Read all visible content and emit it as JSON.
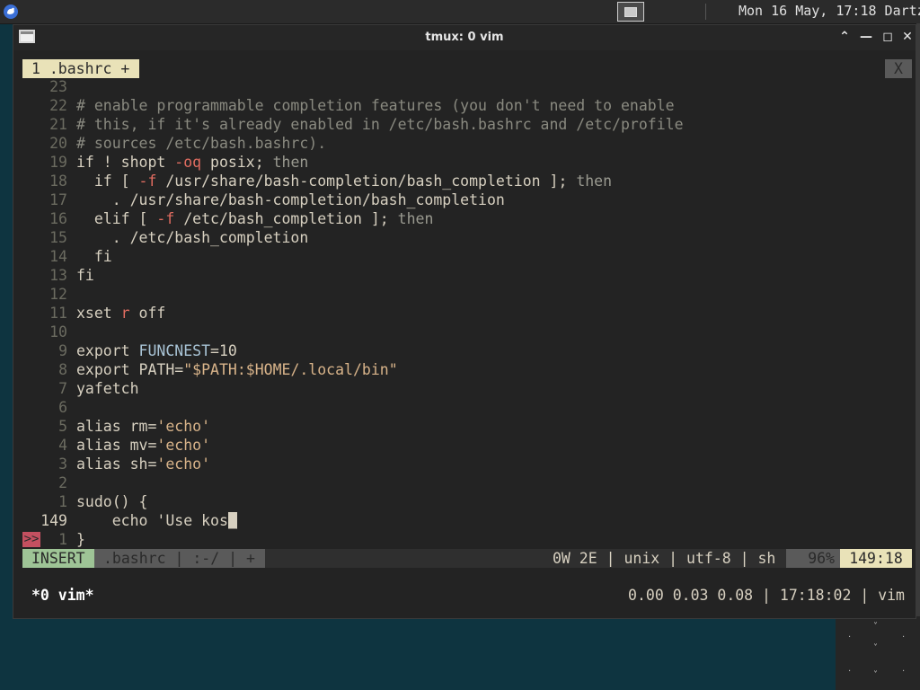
{
  "panel": {
    "clock": "Mon 16 May, 17:18 Dartz"
  },
  "window": {
    "title": "tmux: 0 vim",
    "buttons": {
      "chevron": "⌃",
      "minimize": "—",
      "maximize": "◻",
      "close": "✕"
    }
  },
  "vim": {
    "tab_label": "1 .bashrc +",
    "tab_close": "X",
    "lines": [
      {
        "num": "23",
        "text": ""
      },
      {
        "num": "22",
        "text": "# enable programmable completion features (you don't need to enable"
      },
      {
        "num": "21",
        "text": "# this, if it's already enabled in /etc/bash.bashrc and /etc/profile"
      },
      {
        "num": "20",
        "text": "# sources /etc/bash.bashrc)."
      },
      {
        "num": "19",
        "text": "if ! shopt -oq posix; then"
      },
      {
        "num": "18",
        "text": "  if [ -f /usr/share/bash-completion/bash_completion ]; then"
      },
      {
        "num": "17",
        "text": "    . /usr/share/bash-completion/bash_completion"
      },
      {
        "num": "16",
        "text": "  elif [ -f /etc/bash_completion ]; then"
      },
      {
        "num": "15",
        "text": "    . /etc/bash_completion"
      },
      {
        "num": "14",
        "text": "  fi"
      },
      {
        "num": "13",
        "text": "fi"
      },
      {
        "num": "12",
        "text": ""
      },
      {
        "num": "11",
        "text": "xset r off"
      },
      {
        "num": "10",
        "text": ""
      },
      {
        "num": "9",
        "text": "export FUNCNEST=10"
      },
      {
        "num": "8",
        "text": "export PATH=\"$PATH:$HOME/.local/bin\""
      },
      {
        "num": "7",
        "text": "yafetch"
      },
      {
        "num": "6",
        "text": ""
      },
      {
        "num": "5",
        "text": "alias rm='echo'"
      },
      {
        "num": "4",
        "text": "alias mv='echo'"
      },
      {
        "num": "3",
        "text": "alias sh='echo'"
      },
      {
        "num": "2",
        "text": ""
      },
      {
        "num": "1",
        "text": "sudo() {"
      },
      {
        "num": "149",
        "text": "    echo 'Use kos"
      },
      {
        "num": "1",
        "text": "}"
      }
    ],
    "sign_marker": ">>",
    "status": {
      "mode": "INSERT",
      "file": ".bashrc | :-/ | +",
      "right": "0W 2E | unix | utf-8 | sh",
      "percent": "96%",
      "position": "149:18"
    }
  },
  "tmux": {
    "window": "*0 vim*",
    "right": "0.00 0.03 0.08 | 17:18:02 | vim"
  }
}
